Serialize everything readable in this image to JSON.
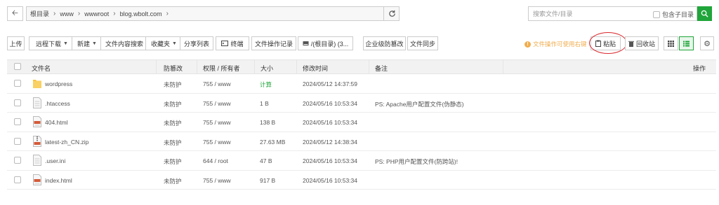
{
  "address_bar": {
    "crumbs": [
      "根目录",
      "www",
      "wwwroot",
      "blog.wbolt.com"
    ],
    "search_placeholder": "搜索文件/目录",
    "include_subdir_label": "包含子目录"
  },
  "toolbar": {
    "upload": "上传",
    "remote_download": "远程下载",
    "new": "新建",
    "content_search": "文件内容搜索",
    "favorites": "收藏夹",
    "share_list": "分享列表",
    "terminal": "终端",
    "operation_log": "文件操作记录",
    "disk": "/(根目录) (3...",
    "tamper_proof": "企业级防篡改",
    "file_sync": "文件同步",
    "tip": "文件操作可使用右键",
    "paste": "粘贴",
    "recycle": "回收站"
  },
  "table": {
    "headers": {
      "name": "文件名",
      "tamper": "防篡改",
      "perm": "权限 / 所有者",
      "size": "大小",
      "mtime": "修改时间",
      "remark": "备注",
      "ops": "操作"
    },
    "rows": [
      {
        "name": "wordpress",
        "icon": "folder-icon",
        "tamper": "未防护",
        "perm": "755 / www",
        "size": "计算",
        "mtime": "2024/05/12 14:37:59",
        "remark": ""
      },
      {
        "name": ".htaccess",
        "icon": "file-icon",
        "tamper": "未防护",
        "perm": "755 / www",
        "size": "1 B",
        "mtime": "2024/05/16 10:53:34",
        "remark": "PS: Apache用户配置文件(伪静态)"
      },
      {
        "name": "404.html",
        "icon": "html-file-icon",
        "tamper": "未防护",
        "perm": "755 / www",
        "size": "138 B",
        "mtime": "2024/05/16 10:53:34",
        "remark": ""
      },
      {
        "name": "latest-zh_CN.zip",
        "icon": "zip-file-icon",
        "tamper": "未防护",
        "perm": "755 / www",
        "size": "27.63 MB",
        "mtime": "2024/05/12 14:38:34",
        "remark": ""
      },
      {
        "name": ".user.ini",
        "icon": "file-icon",
        "tamper": "未防护",
        "perm": "644 / root",
        "size": "47 B",
        "mtime": "2024/05/16 10:53:34",
        "remark": "PS: PHP用户配置文件(防跨站)!"
      },
      {
        "name": "index.html",
        "icon": "html-file-icon",
        "tamper": "未防护",
        "perm": "755 / www",
        "size": "917 B",
        "mtime": "2024/05/16 10:53:34",
        "remark": ""
      }
    ]
  },
  "colors": {
    "accent": "#20a53a",
    "warning": "#f0ad4e",
    "highlight_circle": "#d9262b"
  }
}
